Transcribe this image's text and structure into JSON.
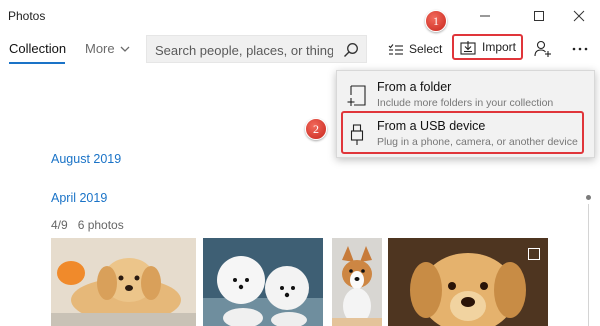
{
  "app": {
    "title": "Photos"
  },
  "toolbar": {
    "collection_label": "Collection",
    "more_label": "More",
    "search_placeholder": "Search people, places, or things",
    "select_label": "Select",
    "import_label": "Import"
  },
  "annotations": {
    "step1": "1",
    "step2": "2",
    "highlight_color": "#e0353a"
  },
  "import_menu": {
    "items": [
      {
        "title": "From a folder",
        "subtitle": "Include more folders in your collection",
        "icon": "folder-add-icon"
      },
      {
        "title": "From a USB device",
        "subtitle": "Plug in a phone, camera, or another device",
        "icon": "usb-icon"
      }
    ]
  },
  "content": {
    "sections": [
      {
        "label": "August 2019"
      },
      {
        "label": "April 2019",
        "date": "4/9",
        "count": "6 photos"
      }
    ]
  },
  "photos": [
    {
      "subject": "golden-retriever-puppy-lying"
    },
    {
      "subject": "two-white-bichon-puppies"
    },
    {
      "subject": "corgi-puppy"
    },
    {
      "subject": "golden-retriever-puppy-face"
    }
  ],
  "colors": {
    "accent": "#1a73c7",
    "annotation_red": "#e0353a"
  }
}
